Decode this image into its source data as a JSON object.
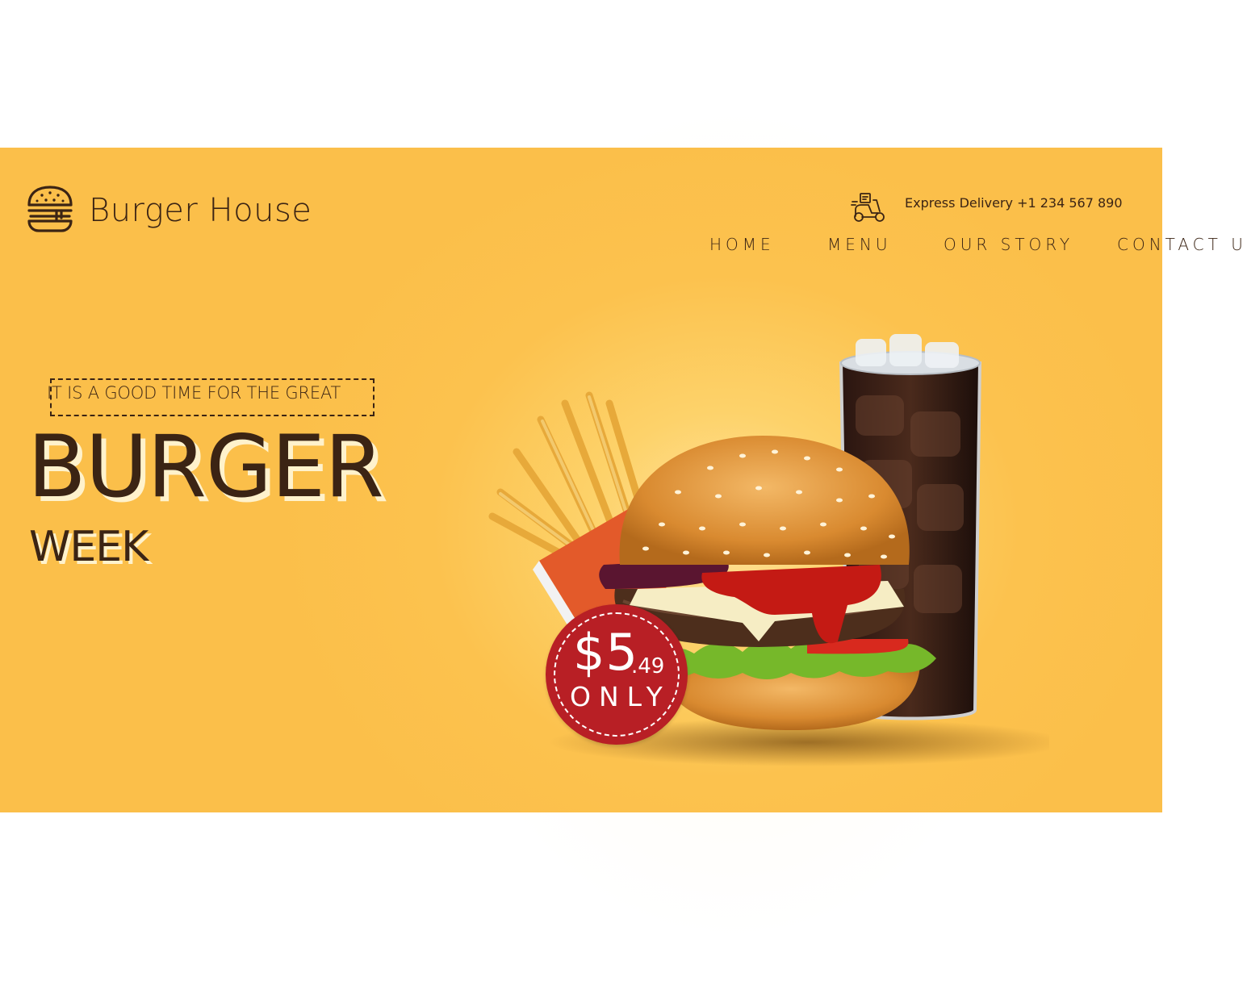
{
  "brand": {
    "name": "Burger House",
    "logo_icon": "burger-icon"
  },
  "delivery": {
    "icon": "delivery-scooter-icon",
    "text": "Express Delivery +1 234 567 890"
  },
  "nav": {
    "items": [
      "HOME",
      "MENU",
      "OUR STORY",
      "CONTACT US"
    ]
  },
  "hero": {
    "tagline": "IT IS A GOOD TIME FOR THE GREAT",
    "title_main": "BURGER",
    "title_sub": "WEEK",
    "image": "burger-fries-and-soda"
  },
  "price": {
    "dollars": "$5",
    "cents": ".49",
    "label": "ONLY"
  },
  "colors": {
    "background": "#fbbf4a",
    "text": "#3b2414",
    "badge": "#b81f25",
    "white": "#ffffff"
  }
}
